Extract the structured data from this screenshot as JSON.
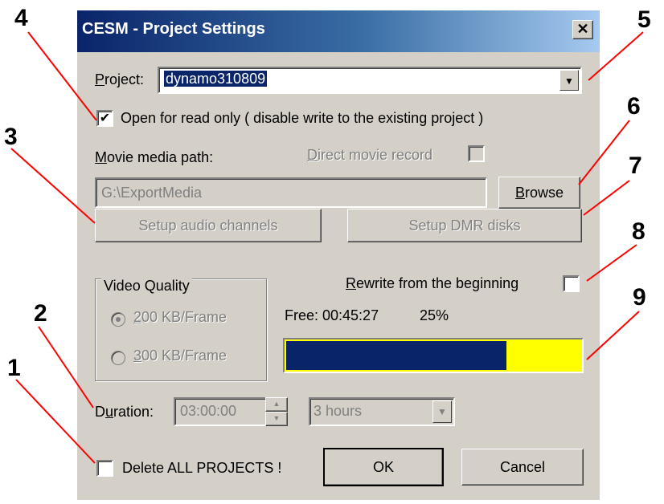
{
  "dialog": {
    "title": "CESM - Project Settings",
    "close_glyph": "✕",
    "project_label_u": "P",
    "project_label_rest": "roject:",
    "project_value": "dynamo310809",
    "read_only_label": "Open for read only ( disable write to the existing project )",
    "read_only_checked": true,
    "movie_path_label_u": "M",
    "movie_path_label_rest": "ovie media path:",
    "direct_record_label_u": "D",
    "direct_record_label_rest": "irect movie record",
    "movie_path_value": "G:\\ExportMedia",
    "browse_label_u": "B",
    "browse_label_rest": "rowse",
    "setup_audio_label": "Setup audio channels",
    "setup_dmr_label": "Setup DMR disks",
    "rewrite_label_u": "R",
    "rewrite_label_rest": "ewrite from the beginning",
    "free_label": "Free: 00:45:27",
    "free_percent_label": "25%",
    "used_fraction": 0.75,
    "video_quality_title": "Video Quality",
    "quality_200_u": "2",
    "quality_200_rest": "00 KB/Frame",
    "quality_300_u": "3",
    "quality_300_rest": "00 KB/Frame",
    "quality_selected": "200 KB/Frame",
    "duration_label_pre": "D",
    "duration_label_u": "u",
    "duration_label_rest": "ration:",
    "duration_value": "03:00:00",
    "duration_select": "3 hours",
    "delete_label": "Delete ALL PROJECTS !",
    "ok_label": "OK",
    "cancel_label": "Cancel"
  },
  "callouts": [
    "1",
    "2",
    "3",
    "4",
    "5",
    "6",
    "7",
    "8",
    "9"
  ],
  "colors": {
    "callout_line": "#ff0000",
    "title_bar": "#0a246a",
    "free_bar": "#ffff00",
    "used_bar": "#0a246a"
  }
}
